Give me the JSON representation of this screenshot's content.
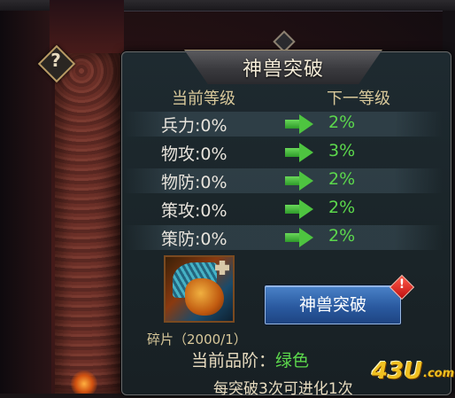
{
  "help": {
    "icon": "question-mark-icon",
    "glyph": "?"
  },
  "panel": {
    "title": "神兽突破",
    "col_current": "当前等级",
    "col_next": "下一等级",
    "stats": [
      {
        "current": "兵力:0%",
        "next": "2%"
      },
      {
        "current": "物攻:0%",
        "next": "3%"
      },
      {
        "current": "物防:0%",
        "next": "2%"
      },
      {
        "current": "策攻:0%",
        "next": "2%"
      },
      {
        "current": "策防:0%",
        "next": "2%"
      }
    ],
    "fragment_label": "碎片（2000/1）",
    "quality_label": "当前品阶：",
    "quality_value": "绿色",
    "break_button": "神兽突破",
    "alert_glyph": "!",
    "note": "每突破3次可进化1次"
  },
  "watermark": {
    "text": "43U",
    "suffix": ".com"
  },
  "colors": {
    "upgrade_green": "#5cd84c",
    "button_blue": "#2a5aa0",
    "header_gold": "#d8c89a"
  }
}
